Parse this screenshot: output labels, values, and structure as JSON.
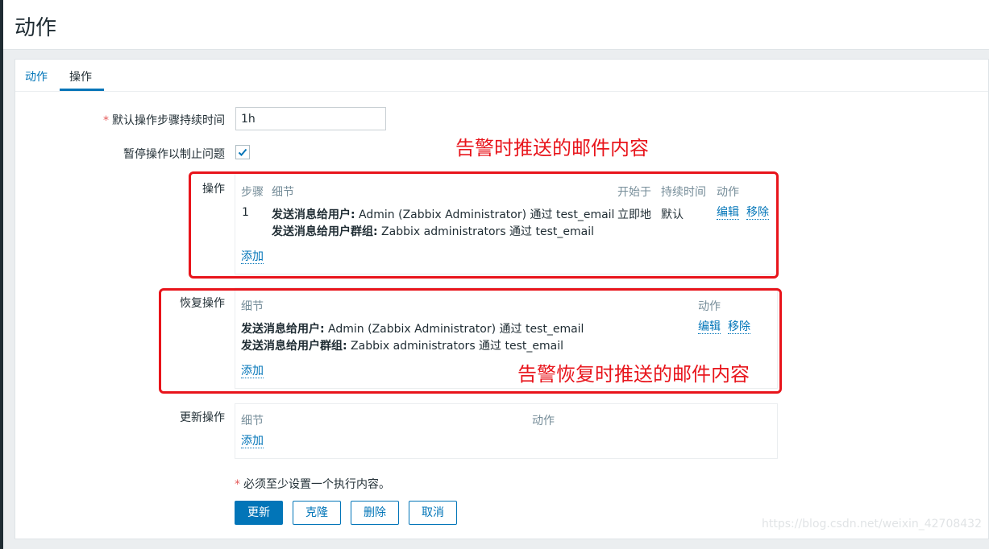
{
  "page_title": "动作",
  "tabs": [
    {
      "label": "动作",
      "active": false
    },
    {
      "label": "操作",
      "active": true
    }
  ],
  "form": {
    "default_duration": {
      "required_mark": "*",
      "label": "默认操作步骤持续时间",
      "value": "1h"
    },
    "pause": {
      "label": "暂停操作以制止问题",
      "checked": true
    }
  },
  "operations": {
    "label": "操作",
    "headers": {
      "step": "步骤",
      "details": "细节",
      "start": "开始于",
      "duration": "持续时间",
      "action": "动作"
    },
    "rows": [
      {
        "step": "1",
        "line1_bold": "发送消息给用户:",
        "line1_text": " Admin (Zabbix Administrator) 通过 test_email",
        "line2_bold": "发送消息给用户群组:",
        "line2_text": " Zabbix administrators 通过 test_email",
        "start": "立即地",
        "duration": "默认",
        "edit": "编辑",
        "remove": "移除"
      }
    ],
    "add": "添加"
  },
  "recovery": {
    "label": "恢复操作",
    "headers": {
      "details": "细节",
      "action": "动作"
    },
    "rows": [
      {
        "line1_bold": "发送消息给用户:",
        "line1_text": " Admin (Zabbix Administrator) 通过 test_email",
        "line2_bold": "发送消息给用户群组:",
        "line2_text": " Zabbix administrators 通过 test_email",
        "edit": "编辑",
        "remove": "移除"
      }
    ],
    "add": "添加"
  },
  "update": {
    "label": "更新操作",
    "headers": {
      "details": "细节",
      "action": "动作"
    },
    "add": "添加"
  },
  "note": {
    "mark": "*",
    "text": "必须至少设置一个执行内容。"
  },
  "buttons": {
    "update": "更新",
    "clone": "克隆",
    "delete": "删除",
    "cancel": "取消"
  },
  "annotations": {
    "alert": "告警时推送的邮件内容",
    "recovery": "告警恢复时推送的邮件内容"
  },
  "watermark": "https://blog.csdn.net/weixin_42708432",
  "colors": {
    "accent": "#0275b8",
    "annotation": "#e8141b"
  }
}
